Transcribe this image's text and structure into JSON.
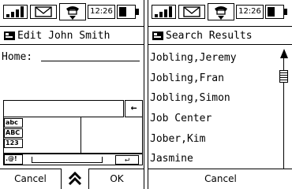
{
  "status_bar": {
    "time": "12:26"
  },
  "edit_screen": {
    "title": "Edit John Smith",
    "field_label": "Home:",
    "keyboard_keys": [
      "abc",
      "ABC",
      "123",
      ".@!"
    ],
    "backspace_label": "←",
    "enter_label": "↵",
    "cancel_label": "Cancel",
    "ok_label": "OK"
  },
  "search_screen": {
    "title": "Search Results",
    "results": [
      "Jobling,Jeremy",
      "Jobling,Fran",
      "Jobling,Simon",
      "Job Center",
      "Jober,Kim",
      "Jasmine"
    ],
    "cancel_label": "Cancel"
  }
}
